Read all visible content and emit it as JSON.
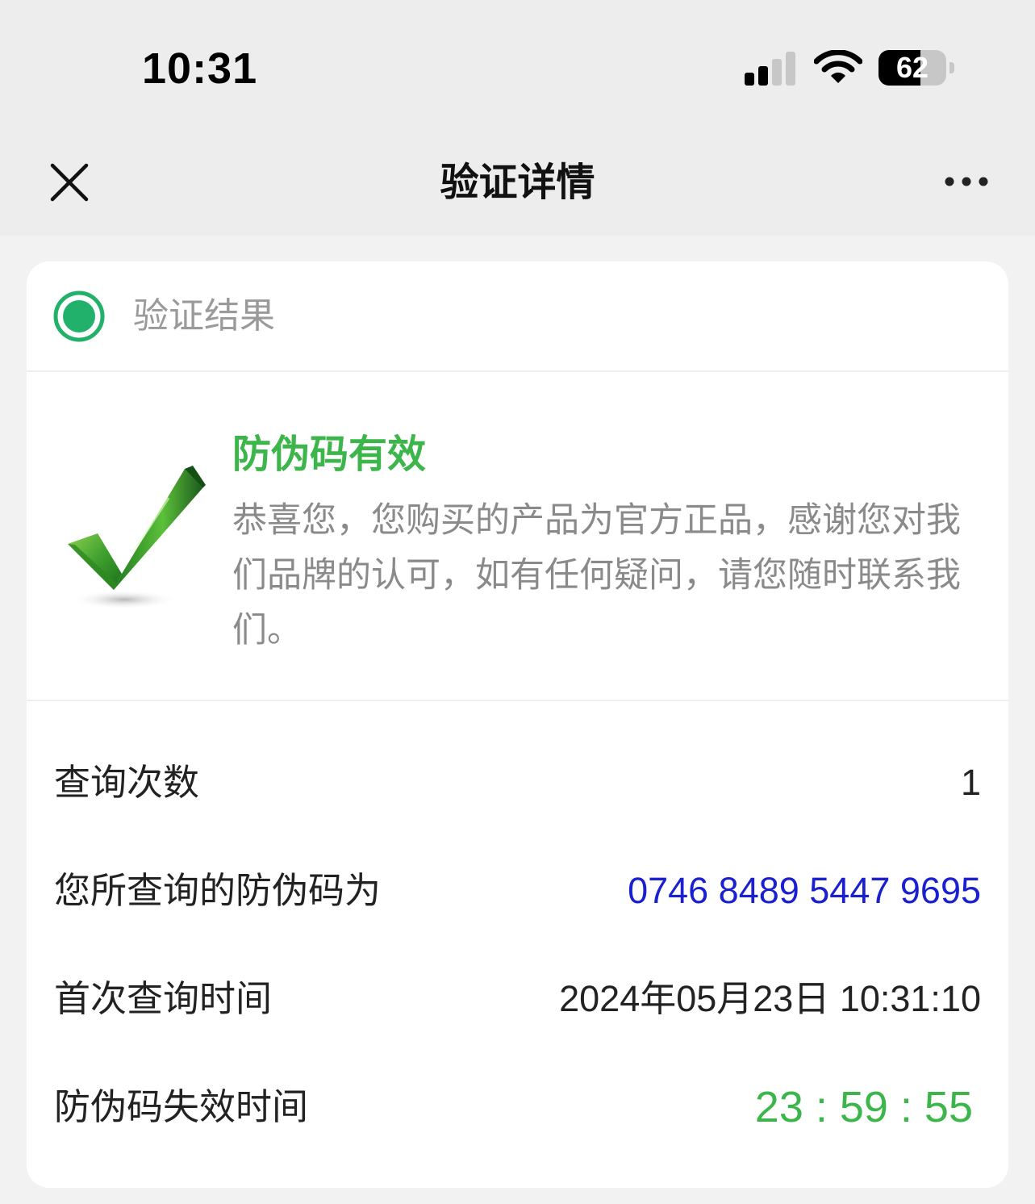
{
  "status_bar": {
    "time": "10:31",
    "battery_level": "62",
    "battery_fraction": 0.62,
    "icons": [
      "cellular-signal-icon",
      "wifi-icon",
      "battery-icon"
    ]
  },
  "nav": {
    "title": "验证详情",
    "close_icon": "close-icon",
    "more_icon": "more-icon"
  },
  "card": {
    "header_label": "验证结果",
    "result": {
      "title": "防伪码有效",
      "description": "恭喜您，您购买的产品为官方正品，感谢您对我们品牌的认可，如有任何疑问，请您随时联系我们。"
    },
    "rows": [
      {
        "label": "查询次数",
        "value": "1"
      },
      {
        "label": "您所查询的防伪码为",
        "value": "0746 8489 5447 9695"
      },
      {
        "label": "首次查询时间",
        "value": "2024年05月23日 10:31:10"
      },
      {
        "label": "防伪码失效时间",
        "value": "23 : 59 : 55"
      }
    ]
  },
  "colors": {
    "accent_green": "#3cb64a",
    "code_blue": "#1a1fcf",
    "muted_gray": "#8a8a8a",
    "background": "#f2f2f2"
  }
}
